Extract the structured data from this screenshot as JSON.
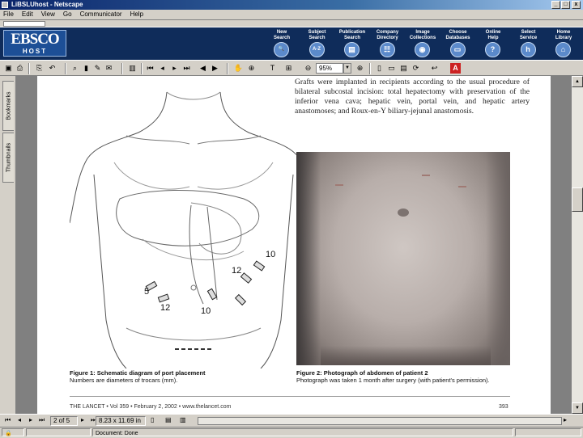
{
  "window": {
    "title": "LiBSLUhost - Netscape",
    "controls": [
      "_",
      "□",
      "x"
    ]
  },
  "menu": [
    "File",
    "Edit",
    "View",
    "Go",
    "Communicator",
    "Help"
  ],
  "banner": {
    "logo_top": "EBSCO",
    "logo_bottom": "HOST",
    "buttons": [
      {
        "line1": "New",
        "line2": "Search",
        "icon": "magnifier-icon",
        "glyph": "🔍"
      },
      {
        "line1": "Subject",
        "line2": "Search",
        "icon": "az-icon",
        "glyph": "A-Z"
      },
      {
        "line1": "Publication",
        "line2": "Search",
        "icon": "publication-icon",
        "glyph": "▤"
      },
      {
        "line1": "Company",
        "line2": "Directory",
        "icon": "company-icon",
        "glyph": "☷"
      },
      {
        "line1": "Image",
        "line2": "Collections",
        "icon": "image-icon",
        "glyph": "◉"
      },
      {
        "line1": "Choose",
        "line2": "Databases",
        "icon": "databases-icon",
        "glyph": "▭"
      },
      {
        "line1": "Online",
        "line2": "Help",
        "icon": "help-icon",
        "glyph": "?"
      },
      {
        "line1": "Select",
        "line2": "Service",
        "icon": "service-icon",
        "glyph": "h"
      },
      {
        "line1": "Home",
        "line2": "Library",
        "icon": "library-icon",
        "glyph": "⌂"
      }
    ]
  },
  "toolbar": {
    "zoom_value": "95%"
  },
  "sidetabs": [
    "Bookmarks",
    "Thumbnails"
  ],
  "document": {
    "paragraph": "Grafts were implanted in recipients according to the usual procedure of bilateral subcostal incision: total hepatectomy with preservation of the inferior vena cava; hepatic vein, portal vein, and hepatic artery anastomoses; and Roux-en-Y biliary-jejunal anastomosis.",
    "fig1_title": "Figure 1: Schematic diagram of port placement",
    "fig1_sub": "Numbers are diameters of trocars (mm).",
    "fig2_title": "Figure 2: Photograph of abdomen of patient 2",
    "fig2_sub": "Photograph was taken 1 month after surgery (with patient's permission).",
    "trocar_labels": [
      "10",
      "12",
      "5",
      "12",
      "10"
    ],
    "footer_left": "THE LANCET • Vol 359 • February 2, 2002 • www.thelancet.com",
    "footer_right": "393"
  },
  "navbar": {
    "page_indicator": "2 of 5",
    "page_size": "8.23 x 11.69 in"
  },
  "status": {
    "text": "Document: Done"
  }
}
